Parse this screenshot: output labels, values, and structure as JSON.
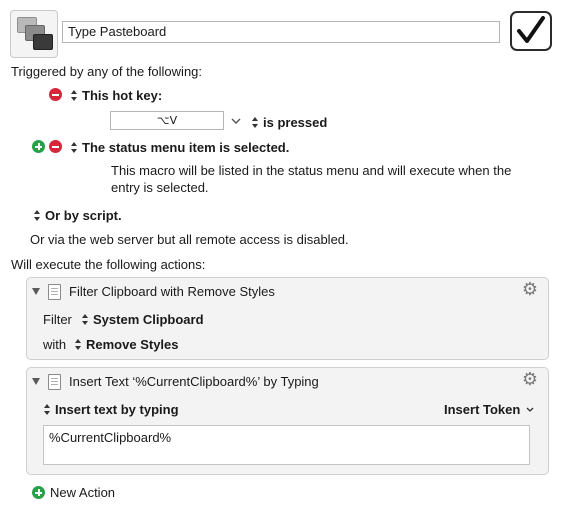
{
  "macro": {
    "name": "Type Pasteboard",
    "enabled_icon": "checkmark-icon"
  },
  "triggers": {
    "heading": "Triggered by any of the following:",
    "hotkey": {
      "label": "This hot key:",
      "keys": "⌥V",
      "condition": "is pressed"
    },
    "status_menu": {
      "label": "The status menu item is selected.",
      "description_line1": "This macro will be listed in the status menu and will execute when the",
      "description_line2": "entry is selected."
    },
    "script": {
      "label": "Or by script."
    },
    "web_server_note": "Or via the web server but all remote access is disabled."
  },
  "actions": {
    "heading": "Will execute the following actions:",
    "filter": {
      "title": "Filter Clipboard with Remove Styles",
      "filter_label": "Filter",
      "filter_value": "System Clipboard",
      "with_label": "with",
      "with_value": "Remove Styles"
    },
    "insert": {
      "title": "Insert Text ‘%CurrentClipboard%’ by Typing",
      "mode": "Insert text by typing",
      "token_label": "Insert Token",
      "text": "%CurrentClipboard%"
    },
    "new_action": "New Action"
  },
  "colors": {
    "remove": "#d7263b",
    "add": "#27a04a"
  }
}
